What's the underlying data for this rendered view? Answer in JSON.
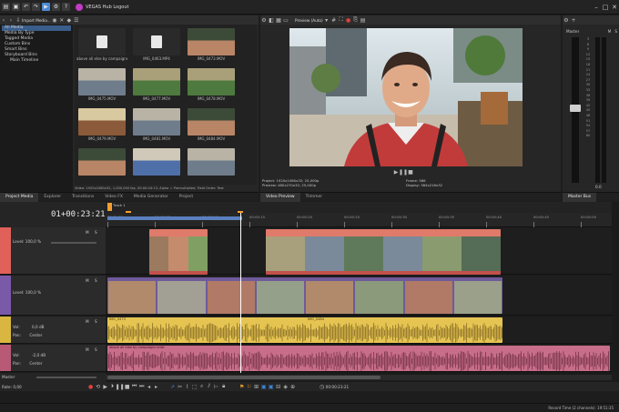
{
  "app": {
    "title": "VEGAS Hub Logout",
    "import_media": "Import Media..."
  },
  "explorer": {
    "tree": [
      "All Media",
      "Media By Type",
      "Tagged Media",
      "Custom Bins",
      "Smart Bins",
      "Storyboard Bins",
      "Main Timeline"
    ],
    "files": [
      {
        "name": "above all else by campaigns bribt.wav",
        "kind": "audio"
      },
      {
        "name": "IMG_0463.MP4",
        "kind": "audio"
      },
      {
        "name": "IMG_0473.MOV",
        "kind": "video",
        "tone": "person"
      },
      {
        "name": "IMG_0475.MOV",
        "kind": "video",
        "tone": "street"
      },
      {
        "name": "IMG_0477.MOV",
        "kind": "video",
        "tone": "green"
      },
      {
        "name": "IMG_0478.MOV",
        "kind": "video",
        "tone": "green"
      },
      {
        "name": "IMG_0479.MOV",
        "kind": "video",
        "tone": "food"
      },
      {
        "name": "IMG_0481.MOV",
        "kind": "video",
        "tone": "street"
      },
      {
        "name": "IMG_0484.MOV",
        "kind": "video",
        "tone": "person"
      },
      {
        "name": "",
        "kind": "video",
        "tone": "person"
      },
      {
        "name": "",
        "kind": "video",
        "tone": "sign"
      },
      {
        "name": "",
        "kind": "video",
        "tone": "street"
      }
    ],
    "status": "Video: 1920x1080x32, 1,000,000 fps, 00:00:04:13, Alpha = Premultiplied, Field Order: Text"
  },
  "left_tabs": [
    "Project Media",
    "Explorer",
    "Transitions",
    "Video FX",
    "Media Generator",
    "Project"
  ],
  "preview": {
    "dropdown": "Preview (Auto)",
    "project_label": "Project:",
    "project_value": "1920x1080x32; 25,000p",
    "preview_label": "Preview:",
    "preview_value": "480x270x32; 25,000p",
    "frame_label": "Frame:",
    "frame_value": "586",
    "display_label": "Display:",
    "display_value": "384x216x32"
  },
  "right_tabs": [
    "Video Preview",
    "Trimmer"
  ],
  "master": {
    "label": "Master",
    "m": "M",
    "s": "S",
    "scale": [
      "3",
      "6",
      "9",
      "12",
      "15",
      "18",
      "21",
      "24",
      "27",
      "30",
      "33",
      "36",
      "39",
      "42",
      "45",
      "48",
      "51",
      "54",
      "57",
      "60"
    ],
    "level": "0.0",
    "tab": "Master Bus"
  },
  "timeline": {
    "timecode": "01+00:23:21",
    "marker_label": "Track 1",
    "ruler": [
      "00:00:00",
      "00:00:05",
      "00:00:10",
      "00:00:15",
      "00:00:20",
      "00:00:25",
      "00:00:30",
      "00:00:35",
      "00:00:40",
      "00:00:45",
      "00:00:50"
    ],
    "tracks": [
      {
        "level_label": "Level: 100,0 %",
        "color": "#e0605a"
      },
      {
        "level_label": "Level: 100,0 %",
        "color": "#7a5aa8"
      },
      {
        "vol_label": "Vol:",
        "vol_value": "0,0 dB",
        "pan_label": "Pan:",
        "pan_value": "Center",
        "color": "#d9b640"
      },
      {
        "vol_label": "Vol:",
        "vol_value": "-2,0 dB",
        "pan_label": "Pan:",
        "pan_value": "Center",
        "color": "#b85a75"
      }
    ],
    "clips": {
      "audio1_name": "IMG_0473",
      "audio1b_name": "IMG_0484",
      "audio2_name": "above all else by campaigns bribt",
      "video_names": [
        "IMG_0475",
        "IMG_0477",
        "IMG_0478",
        "IMG_0481",
        "IMG_0479",
        "IMG_0473"
      ]
    },
    "master_label": "Master",
    "rate_label": "Rate: 0,00",
    "end_time": "00:00:23:21"
  },
  "statusbar": {
    "record_time": "Record Time (2 channels): 19:51:35"
  },
  "colors": {
    "accent_blue": "#3a86d6",
    "video_track": "#e0605a",
    "video_track2": "#7a5aa8",
    "audio_track": "#d9b640",
    "audio_track2": "#b85a75",
    "timeline_orange": "#f0a030"
  }
}
